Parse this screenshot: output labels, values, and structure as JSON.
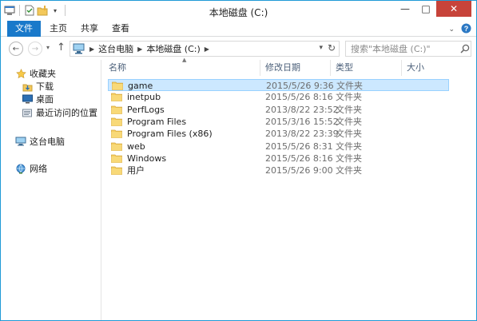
{
  "window": {
    "title": "本地磁盘 (C:)",
    "controls": {
      "minimize": "—",
      "maximize": "□",
      "close": "✕"
    }
  },
  "ribbon": {
    "tabs": [
      {
        "label": "文件",
        "active": true
      },
      {
        "label": "主页"
      },
      {
        "label": "共享"
      },
      {
        "label": "查看"
      }
    ],
    "accent": "#1979ca"
  },
  "address": {
    "crumbs": [
      "这台电脑",
      "本地磁盘 (C:)"
    ]
  },
  "search": {
    "placeholder": "搜索\"本地磁盘 (C:)\""
  },
  "nav": {
    "favorites_label": "收藏夹",
    "favorites": [
      "下载",
      "桌面",
      "最近访问的位置"
    ],
    "this_pc": "这台电脑",
    "network": "网络"
  },
  "columns": {
    "name": "名称",
    "date": "修改日期",
    "type": "类型",
    "size": "大小"
  },
  "files": [
    {
      "name": "game",
      "date": "2015/5/26 9:36",
      "type": "文件夹",
      "selected": true
    },
    {
      "name": "inetpub",
      "date": "2015/5/26 8:16",
      "type": "文件夹"
    },
    {
      "name": "PerfLogs",
      "date": "2013/8/22 23:52",
      "type": "文件夹"
    },
    {
      "name": "Program Files",
      "date": "2015/3/16 15:52",
      "type": "文件夹"
    },
    {
      "name": "Program Files (x86)",
      "date": "2013/8/22 23:39",
      "type": "文件夹"
    },
    {
      "name": "web",
      "date": "2015/5/26 8:31",
      "type": "文件夹"
    },
    {
      "name": "Windows",
      "date": "2015/5/26 8:16",
      "type": "文件夹"
    },
    {
      "name": "用户",
      "date": "2015/5/26 9:00",
      "type": "文件夹"
    }
  ]
}
